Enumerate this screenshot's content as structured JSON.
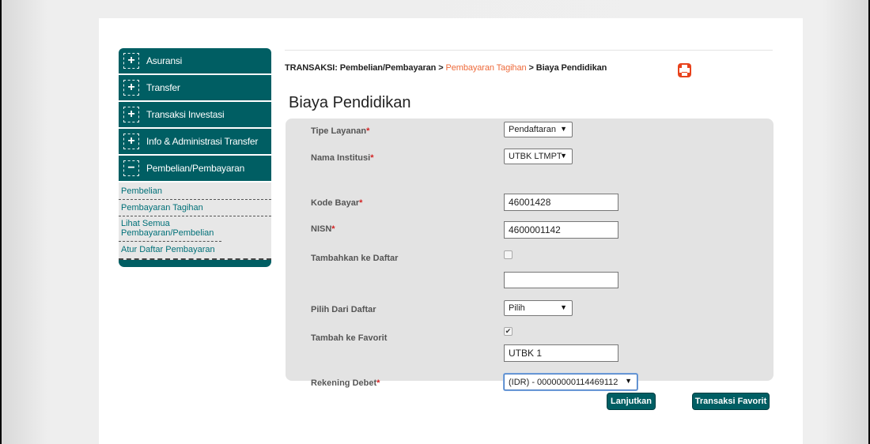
{
  "sidebar": {
    "menu": [
      {
        "label": "Asuransi",
        "icon": "plus-icon",
        "symbol": "+"
      },
      {
        "label": "Transfer",
        "icon": "plus-icon",
        "symbol": "+"
      },
      {
        "label": "Transaksi Investasi",
        "icon": "plus-icon",
        "symbol": "+"
      },
      {
        "label": "Info & Administrasi Transfer",
        "icon": "plus-icon",
        "symbol": "+"
      },
      {
        "label": "Pembelian/Pembayaran",
        "icon": "minus-icon",
        "symbol": "−"
      }
    ],
    "submenu": [
      {
        "label": "Pembelian"
      },
      {
        "label": "Pembayaran Tagihan"
      },
      {
        "label": "Lihat Semua Pembayaran/Pembelian"
      },
      {
        "label": "Atur Daftar Pembayaran"
      }
    ]
  },
  "breadcrumb": {
    "prefix": "TRANSAKSI: Pembelian/Pembayaran > ",
    "active": "Pembayaran Tagihan",
    "suffix": " > Biaya Pendidikan"
  },
  "page_title": "Biaya Pendidikan",
  "form": {
    "tipe_layanan": {
      "label": "Tipe Layanan",
      "required_mark": "*",
      "value": "Pendaftaran"
    },
    "nama_institusi": {
      "label": "Nama Institusi",
      "required_mark": "*",
      "value": "UTBK LTMPT"
    },
    "kode_bayar": {
      "label": "Kode Bayar",
      "required_mark": "*",
      "value": "46001428"
    },
    "nisn": {
      "label": "NISN",
      "required_mark": "*",
      "value": "4600001142"
    },
    "tambahkan_ke_daftar": {
      "label": "Tambahkan ke Daftar",
      "checked": false,
      "input_value": ""
    },
    "pilih_dari_daftar": {
      "label": "Pilih Dari Daftar",
      "value": "Pilih"
    },
    "tambah_ke_favorit": {
      "label": "Tambah ke Favorit",
      "checked": true,
      "check_glyph": "✔",
      "input_value": "UTBK 1"
    },
    "rekening_debet": {
      "label": "Rekening Debet",
      "required_mark": "*",
      "value": "(IDR) - 00000000114469112"
    }
  },
  "buttons": {
    "lanjutkan": "Lanjutkan",
    "transaksi_favorit": "Transaksi Favorit"
  },
  "dropdown_arrow": "▼",
  "colors": {
    "primary": "#005e63",
    "link": "#ee6a3a",
    "required": "#d32222",
    "panel": "#e3e3e3"
  }
}
